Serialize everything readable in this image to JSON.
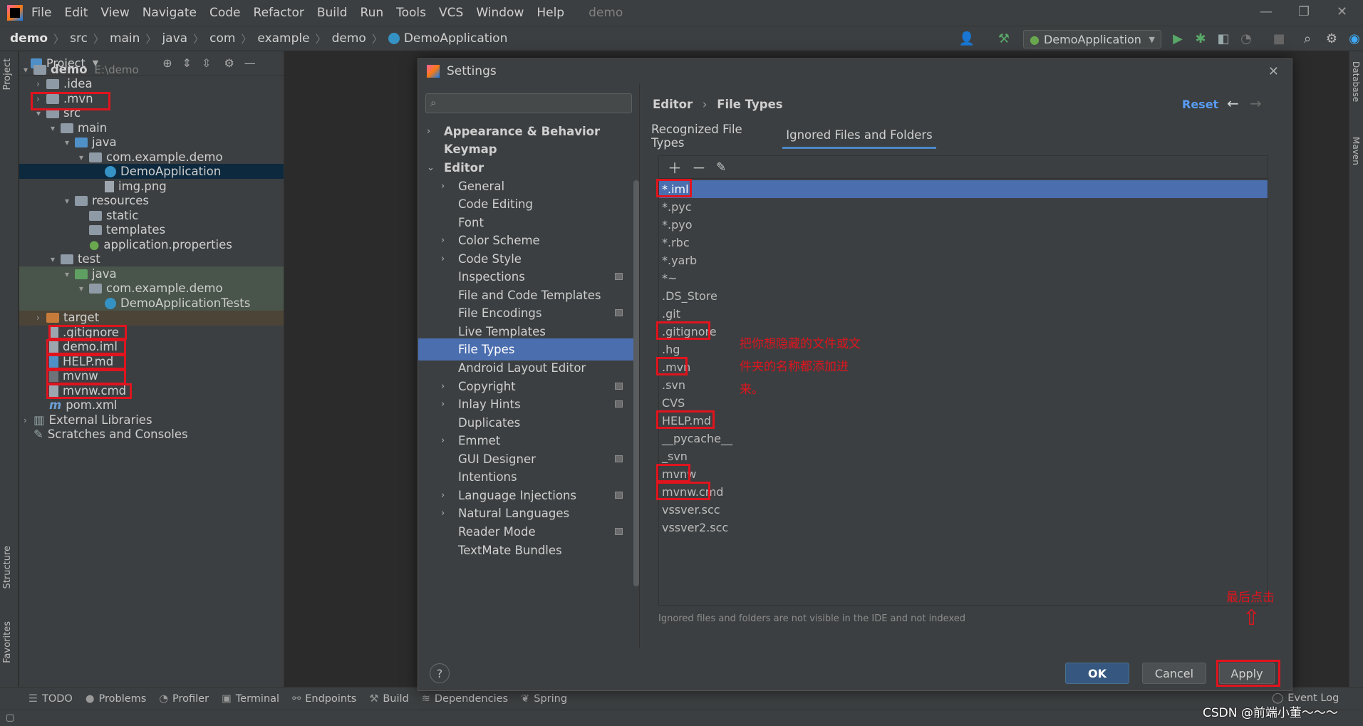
{
  "menubar": {
    "items": [
      "File",
      "Edit",
      "View",
      "Navigate",
      "Code",
      "Refactor",
      "Build",
      "Run",
      "Tools",
      "VCS",
      "Window",
      "Help"
    ],
    "project_name": "demo",
    "window_controls": [
      "—",
      "❐",
      "✕"
    ]
  },
  "navbar": {
    "crumbs": [
      "demo",
      "src",
      "main",
      "java",
      "com",
      "example",
      "demo",
      "DemoApplication"
    ],
    "run_config": "DemoApplication"
  },
  "left_stripe": {
    "project": "Project",
    "structure": "Structure",
    "favorites": "Favorites"
  },
  "right_stripe": {
    "database": "Database",
    "maven": "Maven"
  },
  "project_panel": {
    "title": "Project",
    "tree": [
      {
        "label": "demo",
        "suffix": "E:\\demo"
      },
      {
        "label": ".idea"
      },
      {
        "label": ".mvn"
      },
      {
        "label": "src"
      },
      {
        "label": "main"
      },
      {
        "label": "java"
      },
      {
        "label": "com.example.demo"
      },
      {
        "label": "DemoApplication"
      },
      {
        "label": "img.png"
      },
      {
        "label": "resources"
      },
      {
        "label": "static"
      },
      {
        "label": "templates"
      },
      {
        "label": "application.properties"
      },
      {
        "label": "test"
      },
      {
        "label": "java"
      },
      {
        "label": "com.example.demo"
      },
      {
        "label": "DemoApplicationTests"
      },
      {
        "label": "target"
      },
      {
        "label": ".gitignore"
      },
      {
        "label": "demo.iml"
      },
      {
        "label": "HELP.md"
      },
      {
        "label": "mvnw"
      },
      {
        "label": "mvnw.cmd"
      },
      {
        "label": "pom.xml"
      },
      {
        "label": "External Libraries"
      },
      {
        "label": "Scratches and Consoles"
      }
    ]
  },
  "bottom_bar": {
    "tabs": [
      "TODO",
      "Problems",
      "Profiler",
      "Terminal",
      "Endpoints",
      "Build",
      "Dependencies",
      "Spring"
    ],
    "event_log": "Event Log"
  },
  "dialog": {
    "title": "Settings",
    "search_placeholder": "",
    "nav": [
      {
        "label": "Appearance & Behavior"
      },
      {
        "label": "Keymap"
      },
      {
        "label": "Editor"
      },
      {
        "label": "General"
      },
      {
        "label": "Code Editing"
      },
      {
        "label": "Font"
      },
      {
        "label": "Color Scheme"
      },
      {
        "label": "Code Style"
      },
      {
        "label": "Inspections"
      },
      {
        "label": "File and Code Templates"
      },
      {
        "label": "File Encodings"
      },
      {
        "label": "Live Templates"
      },
      {
        "label": "File Types"
      },
      {
        "label": "Android Layout Editor"
      },
      {
        "label": "Copyright"
      },
      {
        "label": "Inlay Hints"
      },
      {
        "label": "Duplicates"
      },
      {
        "label": "Emmet"
      },
      {
        "label": "GUI Designer"
      },
      {
        "label": "Intentions"
      },
      {
        "label": "Language Injections"
      },
      {
        "label": "Natural Languages"
      },
      {
        "label": "Reader Mode"
      },
      {
        "label": "TextMate Bundles"
      }
    ],
    "breadcrumb": {
      "parent": "Editor",
      "current": "File Types"
    },
    "reset_label": "Reset",
    "tabs": [
      "Recognized File Types",
      "Ignored Files and Folders"
    ],
    "ignored": [
      "*.iml",
      "*.pyc",
      "*.pyo",
      "*.rbc",
      "*.yarb",
      "*~",
      ".DS_Store",
      ".git",
      ".gitignore",
      ".hg",
      ".mvn",
      ".svn",
      "CVS",
      "HELP.md",
      "__pycache__",
      "_svn",
      "mvnw",
      "mvnw.cmd",
      "vssver.scc",
      "vssver2.scc"
    ],
    "hint": "Ignored files and folders are not visible in the IDE and not indexed",
    "buttons": {
      "ok": "OK",
      "cancel": "Cancel",
      "apply": "Apply",
      "help": "?"
    }
  },
  "annotations": {
    "instruction_line1": "把你想隐藏的文件或文",
    "instruction_line2": "件夹的名称都添加进",
    "instruction_line3": "来。",
    "final_click": "最后点击"
  },
  "watermark": "CSDN @前端小董～～～",
  "colors": {
    "accent": "#4b6eaf",
    "annotation": "#e0141e",
    "primary_button": "#365880"
  }
}
